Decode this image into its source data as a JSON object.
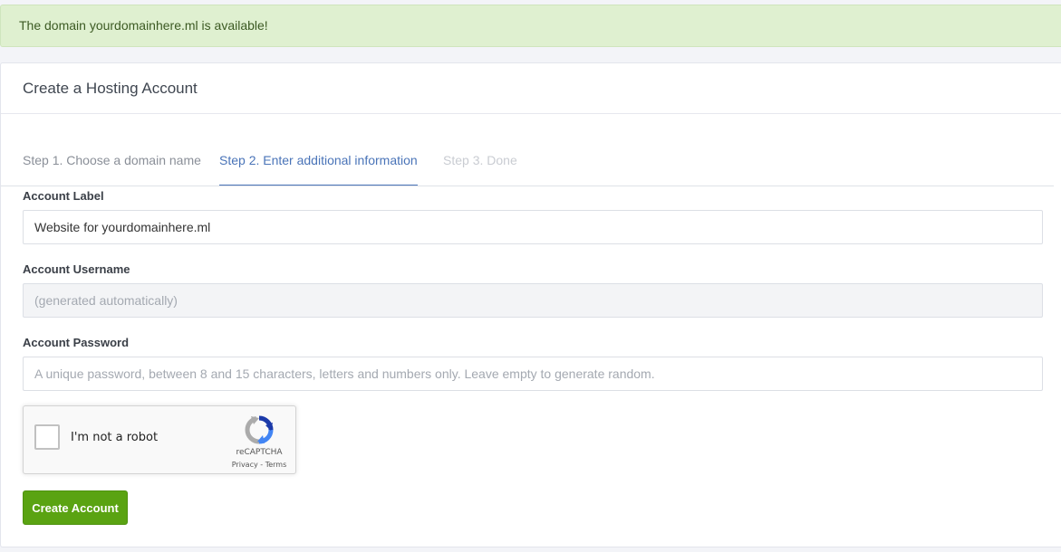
{
  "alert": {
    "message": "The domain yourdomainhere.ml is available!"
  },
  "card": {
    "title": "Create a Hosting Account"
  },
  "steps": [
    {
      "label": "Step 1. Choose a domain name",
      "state": "completed"
    },
    {
      "label": "Step 2. Enter additional information",
      "state": "active"
    },
    {
      "label": "Step 3. Done",
      "state": "upcoming"
    }
  ],
  "form": {
    "account_label": {
      "label": "Account Label",
      "value": "Website for yourdomainhere.ml"
    },
    "account_username": {
      "label": "Account Username",
      "placeholder": "(generated automatically)"
    },
    "account_password": {
      "label": "Account Password",
      "placeholder": "A unique password, between 8 and 15 characters, letters and numbers only. Leave empty to generate random."
    },
    "recaptcha": {
      "label": "I'm not a robot",
      "brand": "reCAPTCHA",
      "links": "Privacy - Terms"
    },
    "submit_label": "Create Account"
  },
  "colors": {
    "alert_bg": "#dff0d0",
    "active_step": "#4a74b8",
    "primary_button": "#5aa312"
  },
  "icons": {
    "recaptcha": "recaptcha-logo-icon"
  }
}
